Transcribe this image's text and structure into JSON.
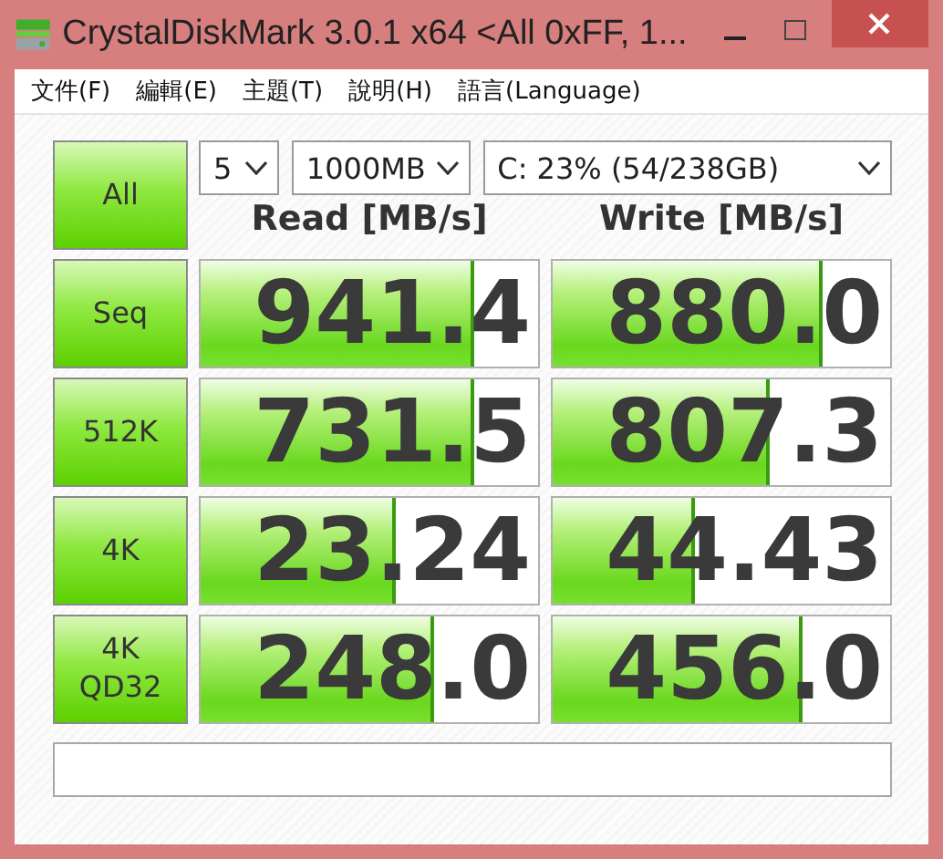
{
  "window": {
    "title": "CrystalDiskMark 3.0.1 x64 <All 0xFF, 1..."
  },
  "menu": [
    "文件(F)",
    "編輯(E)",
    "主題(T)",
    "說明(H)",
    "語言(Language)"
  ],
  "controls": {
    "all_button": "All",
    "count": "5",
    "size": "1000MB",
    "drive": "C: 23% (54/238GB)"
  },
  "headers": [
    "Read [MB/s]",
    "Write [MB/s]"
  ],
  "rows": [
    {
      "label": "Seq",
      "read": {
        "value": "941.4",
        "level": 0.8
      },
      "write": {
        "value": "880.0",
        "level": 0.79
      }
    },
    {
      "label": "512K",
      "read": {
        "value": "731.5",
        "level": 0.8
      },
      "write": {
        "value": "807.3",
        "level": 0.63
      }
    },
    {
      "label": "4K",
      "read": {
        "value": "23.24",
        "level": 0.57
      },
      "write": {
        "value": "44.43",
        "level": 0.41
      }
    },
    {
      "label": "4K\nQD32",
      "read": {
        "value": "248.0",
        "level": 0.68
      },
      "write": {
        "value": "456.0",
        "level": 0.73
      }
    }
  ]
}
